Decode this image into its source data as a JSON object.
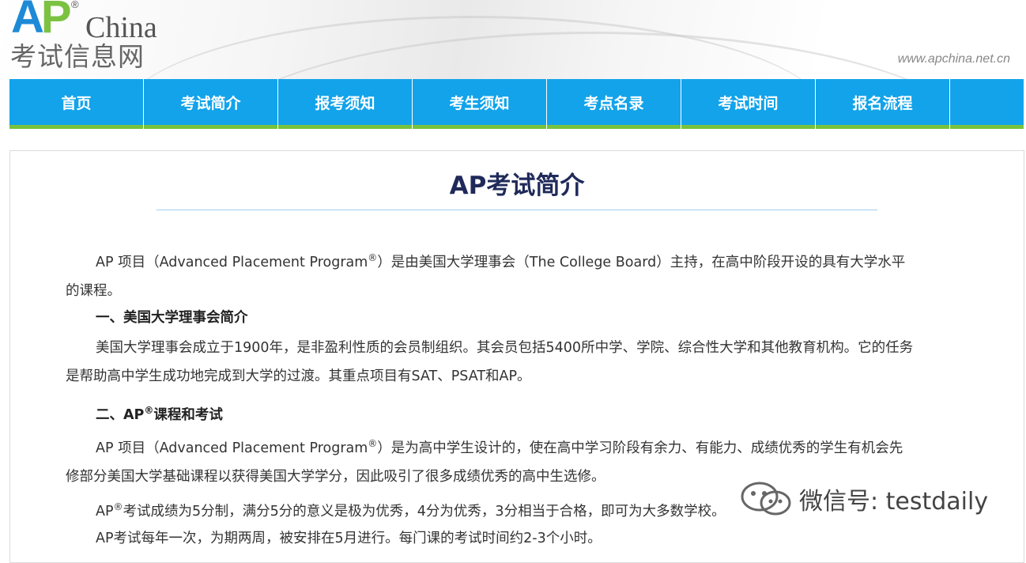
{
  "header": {
    "logo_ap_a": "A",
    "logo_ap_p": "P",
    "logo_reg": "®",
    "logo_china": "China",
    "logo_sub": "考试信息网",
    "url": "www.apchina.net.cn"
  },
  "nav": {
    "items": [
      "首页",
      "考试简介",
      "报考须知",
      "考生须知",
      "考点名录",
      "考试时间",
      "报名流程"
    ]
  },
  "article": {
    "title": "AP考试简介",
    "p1_a": "AP 项目（Advanced Placement Program",
    "p1_sup": "®",
    "p1_b": "）是由美国大学理事会（The College Board）主持，在高中阶段开设的具有大学水平",
    "p1_c": "的课程。",
    "h1": "一、美国大学理事会简介",
    "p2_a": "美国大学理事会成立于1900年，是非盈利性质的会员制组织。其会员包括5400所中学、学院、综合性大学和其他教育机构。它的任务",
    "p2_b": "是帮助高中学生成功地完成到大学的过渡。其重点项目有SAT、PSAT和AP。",
    "h2_a": "二、AP",
    "h2_sup": "®",
    "h2_b": "课程和考试",
    "p3_a": "AP 项目（Advanced Placement Program",
    "p3_sup": "®",
    "p3_b": "）是为高中学生设计的，使在高中学习阶段有余力、有能力、成绩优秀的学生有机会先",
    "p3_c": "修部分美国大学基础课程以获得美国大学学分，因此吸引了很多成绩优秀的高中生选修。",
    "p4_a": "AP",
    "p4_sup": "®",
    "p4_b": "考试成绩为5分制，满分5分的意义是极为优秀，4分为优秀，3分相当于合格，即可为大多数学校",
    "p4_c": "。",
    "p5": "AP考试每年一次，为期两周，被安排在5月进行。每门课的考试时间约2-3个小时。"
  },
  "watermark": {
    "text": "微信号: testdaily",
    "icon": "wechat-icon"
  },
  "colors": {
    "nav_bg": "#12a3ea",
    "nav_border": "#78c23d",
    "title": "#1f2a5a"
  }
}
